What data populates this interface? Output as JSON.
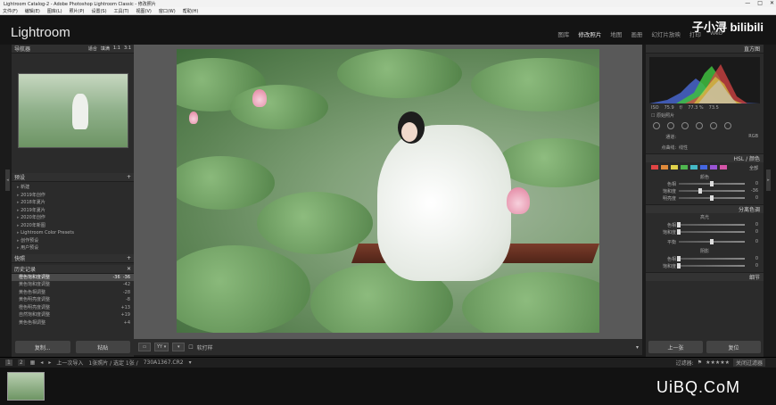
{
  "window": {
    "title": "Lightroom Catalog-2 - Adobe Photoshop Lightroom Classic - 修改照片",
    "controls": [
      "—",
      "□",
      "✕"
    ]
  },
  "menu": [
    "文件(F)",
    "编辑(E)",
    "图库(L)",
    "照片(P)",
    "设置(S)",
    "工具(T)",
    "视图(V)",
    "窗口(W)",
    "帮助(H)"
  ],
  "app": {
    "logo": "Lightroom",
    "modules": [
      "图库",
      "修改照片",
      "地图",
      "画册",
      "幻灯片放映",
      "打印",
      "Web"
    ],
    "watermark_top": "子小浔 bilibili"
  },
  "left_panel": {
    "navigator": {
      "title": "导航器",
      "zoom": [
        "适合",
        "填满",
        "1:1",
        "3:1"
      ]
    },
    "presets": {
      "title": "预设",
      "items": [
        "新建",
        "2019年创作",
        "2018年夏片",
        "2019年夏片",
        "2020年创作",
        "2020年新图",
        "Lightroom Color Presets",
        "创作预设",
        "用户预设"
      ]
    },
    "snapshots": {
      "title": "快照"
    },
    "history": {
      "title": "历史记录",
      "items": [
        {
          "name": "橙色饱和度调整",
          "a": "-36",
          "b": "-36"
        },
        {
          "name": "黄色饱和度调整",
          "a": "-42",
          "b": ""
        },
        {
          "name": "黄色色相调整",
          "a": "-28",
          "b": ""
        },
        {
          "name": "黄色明亮度调整",
          "a": "-8",
          "b": ""
        },
        {
          "name": "橙色明亮度调整",
          "a": "+13",
          "b": ""
        },
        {
          "name": "自然饱和度调整",
          "a": "+19",
          "b": ""
        },
        {
          "name": "黄色色相调整",
          "a": "+4",
          "b": ""
        }
      ]
    },
    "buttons": {
      "copy": "复制...",
      "paste": "粘贴"
    }
  },
  "center_toolbar": {
    "soft_proof": "软打样"
  },
  "right_panel": {
    "histogram": {
      "title": "直方图",
      "exif": [
        "ISO",
        "75.9",
        "f/",
        "77.3 %",
        "73.5"
      ],
      "original_photo": "原始照片"
    },
    "tone": {
      "channel_label": "通道:",
      "channel": "RGB",
      "point_curve_label": "点曲线:",
      "point_curve": "线性"
    },
    "hsl": {
      "title": "HSL / 颜色",
      "mode": "全部",
      "group": "颜色",
      "sliders": [
        {
          "label": "色相",
          "value": "0",
          "pos": 0.5
        },
        {
          "label": "饱和度",
          "value": "-36",
          "pos": 0.32
        },
        {
          "label": "明亮度",
          "value": "0",
          "pos": 0.5
        }
      ],
      "swatch_colors": [
        "#e04444",
        "#e08a3a",
        "#e0d14a",
        "#4fb64f",
        "#44b9c5",
        "#4466e0",
        "#9a55d4",
        "#d455a8"
      ]
    },
    "split_toning": {
      "title": "分离色调",
      "highlights": "高光",
      "highlight_sliders": [
        {
          "label": "色相",
          "value": "0",
          "pos": 0.0
        },
        {
          "label": "饱和度",
          "value": "0",
          "pos": 0.0
        }
      ],
      "balance": {
        "label": "平衡",
        "value": "0",
        "pos": 0.5
      },
      "shadows": "阴影",
      "shadow_sliders": [
        {
          "label": "色相",
          "value": "0",
          "pos": 0.0
        },
        {
          "label": "饱和度",
          "value": "0",
          "pos": 0.0
        }
      ]
    },
    "detail": {
      "title": "细节"
    },
    "buttons": {
      "previous": "上一张",
      "reset": "复位"
    }
  },
  "filmstrip": {
    "page_a": "1",
    "page_b": "2",
    "nav_text": "上一次导入",
    "count_text": "1张照片 / 选定 1张 /",
    "filename": "730A1367.CR2",
    "filter_label": "过滤器:",
    "filter_state": "关闭过滤器"
  },
  "watermark_bottom": "UiBQ.CoM"
}
